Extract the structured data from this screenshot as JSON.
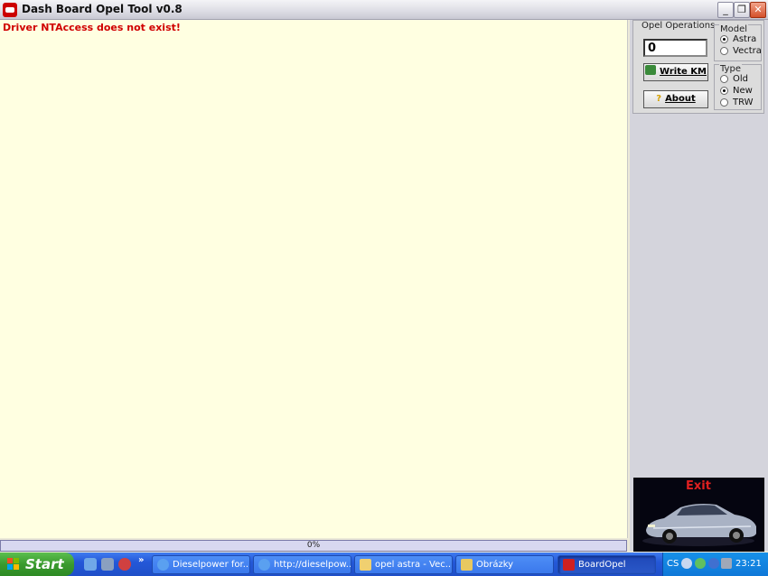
{
  "window": {
    "title": "Dash Board Opel Tool v0.8",
    "buttons": {
      "minimize": "_",
      "restore": "❐",
      "close": "✕"
    }
  },
  "log": {
    "message": "Driver NTAccess does not exist!",
    "message_color": "#d00000",
    "background": "#ffffe1"
  },
  "operations": {
    "group_label": "Opel Operations",
    "km_value": "0",
    "write_button": "Write KM",
    "about_button": "About",
    "model": {
      "label": "Model",
      "options": [
        "Astra",
        "Vectra"
      ],
      "selected": "Astra"
    },
    "type": {
      "label": "Type",
      "options": [
        "Old",
        "New",
        "TRW"
      ],
      "selected": "New"
    }
  },
  "exit": {
    "label": "Exit"
  },
  "progress": {
    "text": "0%",
    "value": 0
  },
  "taskbar": {
    "start_label": "Start",
    "tasks": [
      {
        "label": "Dieselpower for...",
        "icon": "ie-icon"
      },
      {
        "label": "http://dieselpow...",
        "icon": "ie-icon"
      },
      {
        "label": "opel astra  - Vec...",
        "icon": "folder-icon"
      },
      {
        "label": "Obrázky",
        "icon": "folder-pictures-icon"
      },
      {
        "label": "BoardOpel",
        "icon": "opel-app-icon"
      }
    ],
    "active_task": 4,
    "tray": {
      "language": "CS",
      "time": "23:21"
    }
  }
}
